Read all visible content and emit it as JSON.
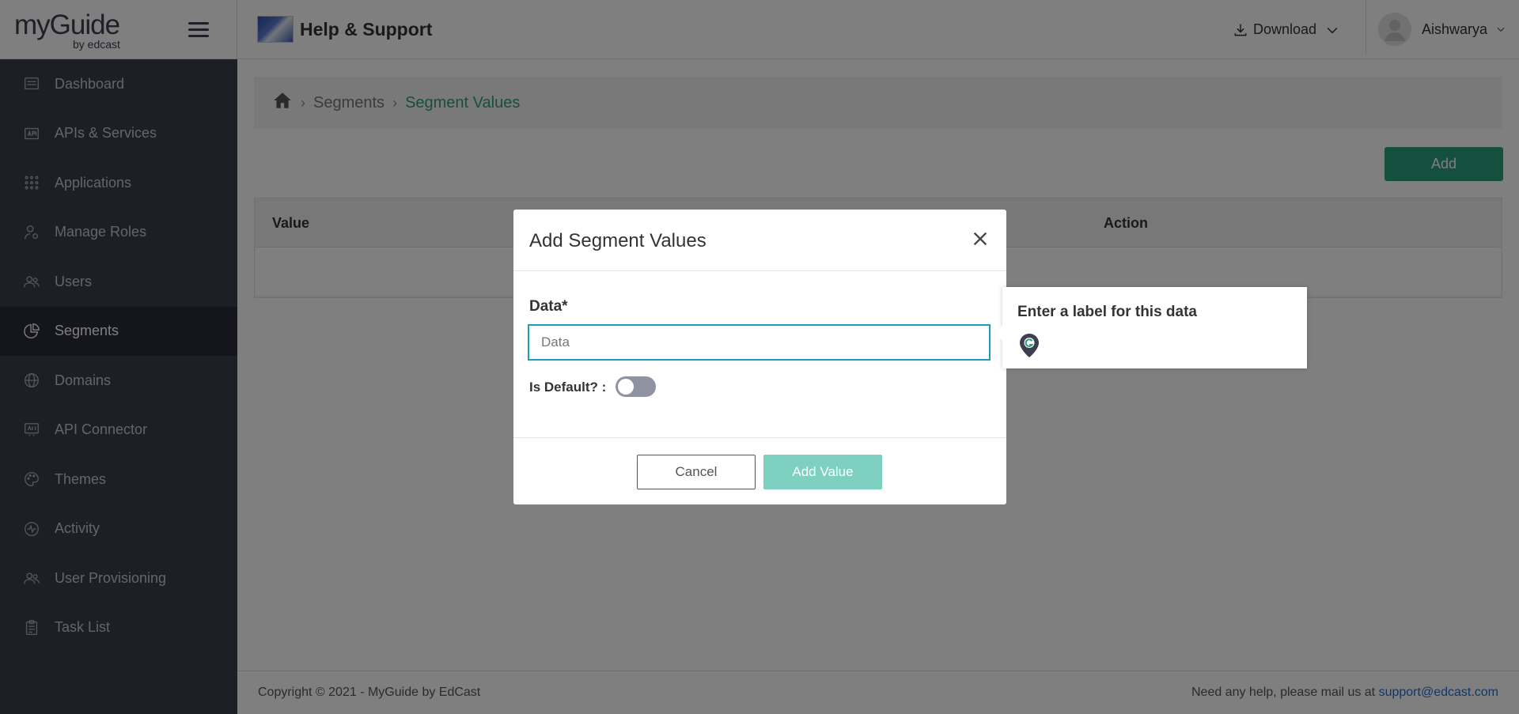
{
  "brand": {
    "logo_text": "myGuide",
    "logo_sub": "by edcast"
  },
  "header": {
    "app_title": "Help & Support",
    "download_label": "Download",
    "user_name": "Aishwarya"
  },
  "sidebar": {
    "items": [
      {
        "label": "Dashboard",
        "icon": "dashboard-icon"
      },
      {
        "label": "APIs & Services",
        "icon": "api-icon"
      },
      {
        "label": "Applications",
        "icon": "grid-icon"
      },
      {
        "label": "Manage Roles",
        "icon": "user-gear-icon"
      },
      {
        "label": "Users",
        "icon": "users-icon"
      },
      {
        "label": "Segments",
        "icon": "pie-chart-icon",
        "active": true
      },
      {
        "label": "Domains",
        "icon": "globe-icon"
      },
      {
        "label": "API Connector",
        "icon": "api-connector-icon"
      },
      {
        "label": "Themes",
        "icon": "palette-icon"
      },
      {
        "label": "Activity",
        "icon": "activity-icon"
      },
      {
        "label": "User Provisioning",
        "icon": "users-icon"
      },
      {
        "label": "Task List",
        "icon": "clipboard-icon"
      }
    ]
  },
  "breadcrumb": {
    "parent": "Segments",
    "current": "Segment Values"
  },
  "main": {
    "add_label": "Add"
  },
  "table": {
    "columns": [
      "Value",
      "Action"
    ]
  },
  "modal": {
    "title": "Add Segment Values",
    "data_label": "Data*",
    "data_placeholder": "Data",
    "default_label": "Is Default? :",
    "cancel_label": "Cancel",
    "add_value_label": "Add Value"
  },
  "tooltip": {
    "text": "Enter a label for this data"
  },
  "footer": {
    "copyright": "Copyright © 2021 - MyGuide by EdCast",
    "help_text": "Need any help, please mail us at",
    "help_email": "support@edcast.com"
  },
  "colors": {
    "accent": "#2b9e7d",
    "sidebar_bg": "#3b3e4f",
    "sidebar_active": "#2b2d3b",
    "input_focus": "#1b9fb5"
  }
}
